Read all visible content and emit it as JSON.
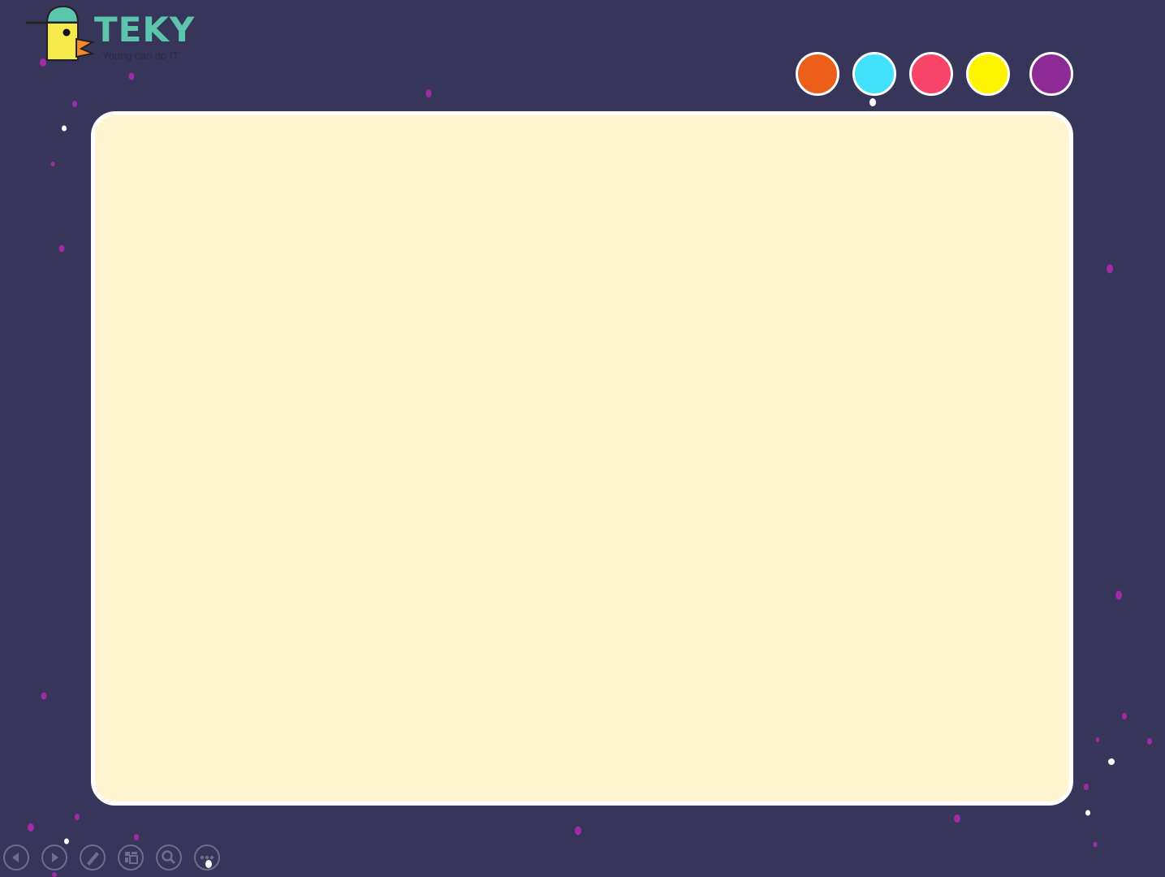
{
  "logo": {
    "wordmark": "TEKY",
    "tagline": "Young can do IT"
  },
  "palette": {
    "swatches": [
      {
        "name": "orange",
        "color": "#ec5f1b"
      },
      {
        "name": "cyan",
        "color": "#42e1fb"
      },
      {
        "name": "pink",
        "color": "#f84469"
      },
      {
        "name": "yellow",
        "color": "#fff400"
      },
      {
        "name": "purple",
        "color": "#8d2a95"
      }
    ]
  },
  "board": {
    "fill_color": "#fff5d1",
    "border_color": "#ffffff"
  },
  "background": {
    "color": "#37365a",
    "confetti_color": "#a22aa6"
  },
  "toolbar": {
    "tools": [
      {
        "icon": "previous-icon"
      },
      {
        "icon": "next-icon"
      },
      {
        "icon": "pen-icon"
      },
      {
        "icon": "slides-icon"
      },
      {
        "icon": "zoom-icon"
      },
      {
        "icon": "more-icon"
      }
    ]
  }
}
